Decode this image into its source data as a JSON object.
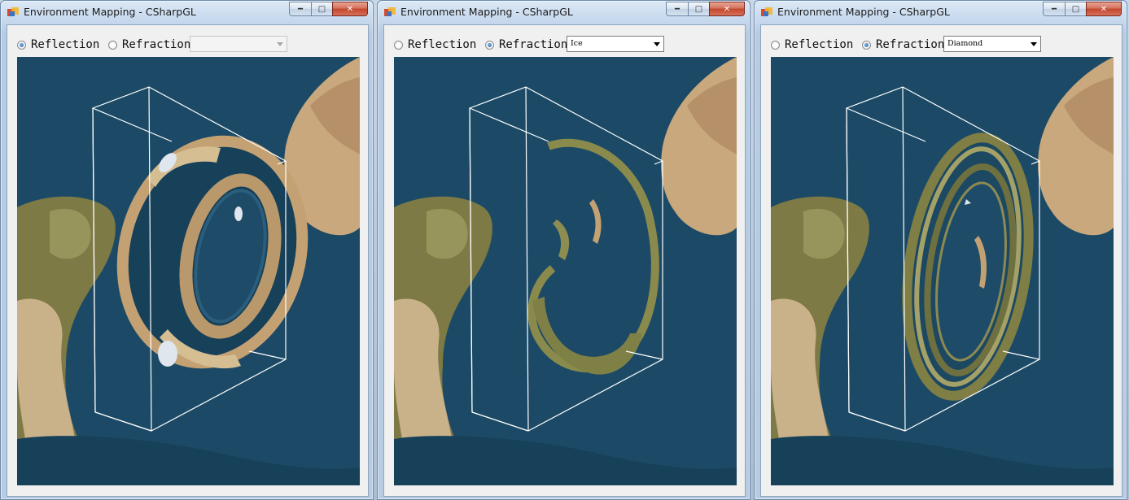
{
  "windows": [
    {
      "title": "Environment Mapping - CSharpGL",
      "options": {
        "reflection_label": "Reflection",
        "refraction_label": "Refraction",
        "selected": "reflection"
      },
      "material": {
        "value": "",
        "enabled": false
      },
      "view": "reflection"
    },
    {
      "title": "Environment Mapping - CSharpGL",
      "options": {
        "reflection_label": "Reflection",
        "refraction_label": "Refraction",
        "selected": "refraction"
      },
      "material": {
        "value": "Ice",
        "enabled": true
      },
      "view": "refraction-ice"
    },
    {
      "title": "Environment Mapping - CSharpGL",
      "options": {
        "reflection_label": "Reflection",
        "refraction_label": "Refraction",
        "selected": "refraction"
      },
      "material": {
        "value": "Diamond",
        "enabled": true
      },
      "view": "refraction-diamond"
    }
  ],
  "icons": {
    "app": "cube-app-icon",
    "minimize": "minimize-icon",
    "maximize": "maximize-icon",
    "close": "close-icon",
    "dropdown": "chevron-down-icon"
  },
  "colors": {
    "ocean": "#1c4a66",
    "land_tan": "#c7a57a",
    "land_green": "#7d7a45",
    "wireframe": "#ffffff",
    "close_red": "#c2462c"
  }
}
